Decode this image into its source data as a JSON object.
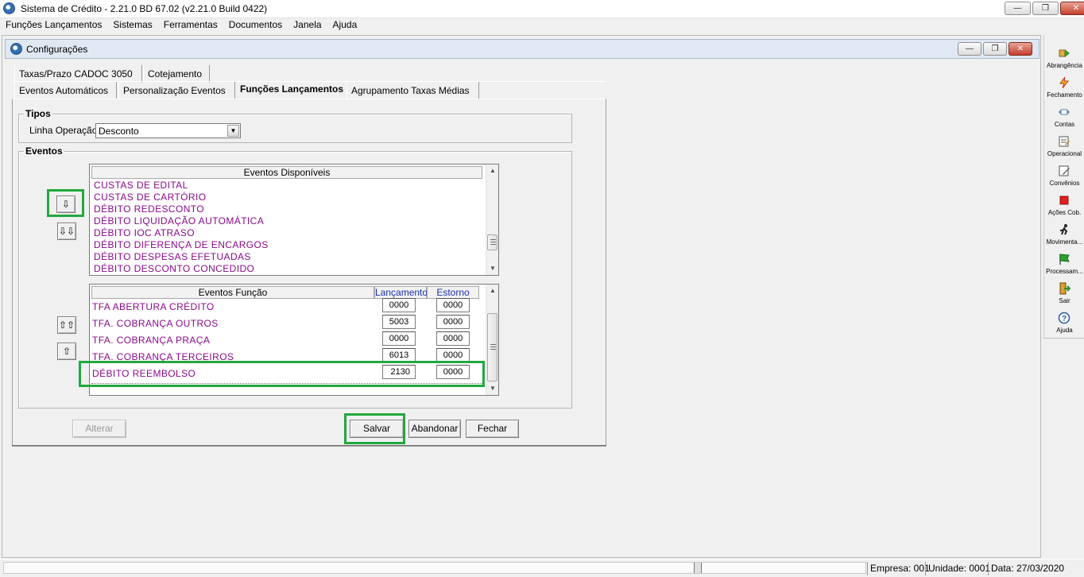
{
  "window": {
    "title": "Sistema de Crédito - 2.21.0 BD 67.02 (v2.21.0 Build 0422)"
  },
  "menu": [
    "Funções Lançamentos",
    "Sistemas",
    "Ferramentas",
    "Documentos",
    "Janela",
    "Ajuda"
  ],
  "child_window": {
    "title": "Configurações"
  },
  "tabs": {
    "row_top": [
      "Taxas/Prazo CADOC 3050",
      "Cotejamento"
    ],
    "row_bottom": [
      "Eventos Automáticos",
      "Personalização Eventos",
      "Funções Lançamentos",
      "Agrupamento Taxas Médias"
    ],
    "active": "Funções Lançamentos"
  },
  "tipos": {
    "group_label": "Tipos",
    "linha_operacao_label": "Linha Operação",
    "linha_operacao_value": "Desconto"
  },
  "eventos": {
    "group_label": "Eventos",
    "disponiveis_header": "Eventos Disponíveis",
    "disponiveis": [
      "CUSTAS DE EDITAL",
      "CUSTAS DE CARTÓRIO",
      "DÉBITO REDESCONTO",
      "DÉBITO LIQUIDAÇÃO AUTOMÁTICA",
      "DÉBITO IOC ATRASO",
      "DÉBITO DIFERENÇA DE ENCARGOS",
      "DÉBITO DESPESAS EFETUADAS",
      "DÉBITO DESCONTO CONCEDIDO"
    ],
    "funcao_headers": {
      "evento": "Eventos Função",
      "lancamento": "Lançamento",
      "estorno": "Estorno"
    },
    "funcao_rows": [
      {
        "name": "TFA ABERTURA CRÉDITO",
        "lancamento": "0000",
        "estorno": "0000"
      },
      {
        "name": "TFA. COBRANÇA OUTROS",
        "lancamento": "5003",
        "estorno": "0000"
      },
      {
        "name": "TFA. COBRANÇA PRAÇA",
        "lancamento": "0000",
        "estorno": "0000"
      },
      {
        "name": "TFA. COBRANÇA TERCEIROS",
        "lancamento": "6013",
        "estorno": "0000"
      },
      {
        "name": "DÉBITO REEMBOLSO",
        "lancamento": "2130",
        "estorno": "0000"
      }
    ],
    "move_buttons": {
      "down_one": "⇩",
      "down_all": "⇩⇩",
      "up_all": "⇧⇧",
      "up_one": "⇧"
    }
  },
  "buttons": {
    "alterar": "Alterar",
    "salvar": "Salvar",
    "abandonar": "Abandonar",
    "fechar": "Fechar"
  },
  "toolbar": [
    {
      "label": "Abrangência",
      "icon": "abrangencia-icon"
    },
    {
      "label": "Fechamento",
      "icon": "fechamento-icon"
    },
    {
      "label": "Contas",
      "icon": "contas-icon"
    },
    {
      "label": "Operacional",
      "icon": "operacional-icon"
    },
    {
      "label": "Convênios",
      "icon": "convenios-icon"
    },
    {
      "label": "Ações Cob.",
      "icon": "acoes-cob-icon"
    },
    {
      "label": "Movimenta...",
      "icon": "movimenta-icon"
    },
    {
      "label": "Processam...",
      "icon": "processam-icon"
    },
    {
      "label": "Sair",
      "icon": "sair-icon"
    },
    {
      "label": "Ajuda",
      "icon": "ajuda-icon"
    }
  ],
  "status": {
    "empresa": "Empresa: 001",
    "unidade": "Unidade: 0001",
    "data": "Data:  27/03/2020"
  },
  "colors": {
    "event_text": "#8a0a8a",
    "highlight": "#22a83e",
    "header_blue": "#1a2fb0"
  }
}
